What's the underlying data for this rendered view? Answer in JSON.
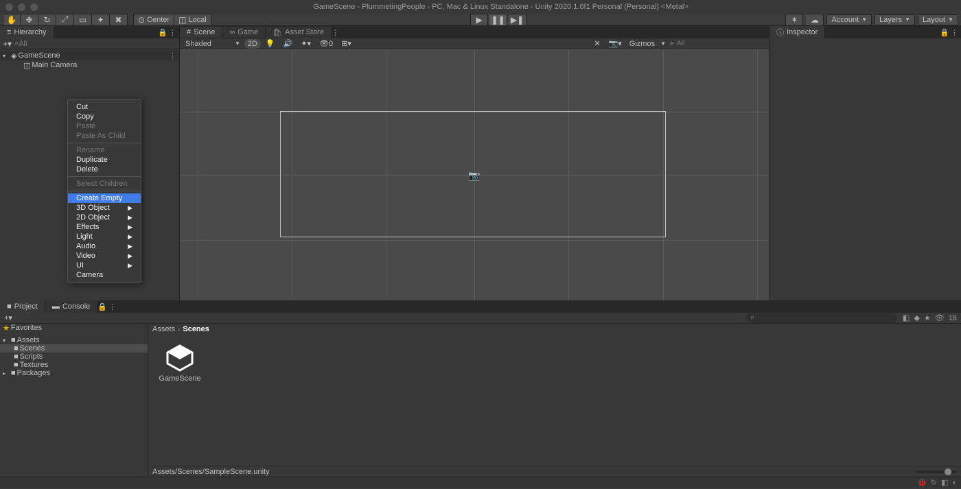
{
  "titlebar": {
    "title": "GameScene - PlummetingPeople - PC, Mac & Linux Standalone - Unity 2020.1.6f1 Personal (Personal) <Metal>"
  },
  "toolbar": {
    "center_label": "Center",
    "local_label": "Local",
    "account_label": "Account",
    "layers_label": "Layers",
    "layout_label": "Layout"
  },
  "hierarchy": {
    "tab_label": "Hierarchy",
    "search_placeholder": "All",
    "scene_name": "GameScene",
    "items": [
      "Main Camera"
    ]
  },
  "scene": {
    "tabs": {
      "scene": "Scene",
      "game": "Game",
      "asset_store": "Asset Store"
    },
    "shaded": "Shaded",
    "mode_2d": "2D",
    "gizmos": "Gizmos",
    "search_placeholder": "All"
  },
  "inspector": {
    "tab_label": "Inspector"
  },
  "context_menu": {
    "cut": "Cut",
    "copy": "Copy",
    "paste": "Paste",
    "paste_as_child": "Paste As Child",
    "rename": "Rename",
    "duplicate": "Duplicate",
    "delete": "Delete",
    "select_children": "Select Children",
    "create_empty": "Create Empty",
    "obj3d": "3D Object",
    "obj2d": "2D Object",
    "effects": "Effects",
    "light": "Light",
    "audio": "Audio",
    "video": "Video",
    "ui": "UI",
    "camera": "Camera"
  },
  "project": {
    "tab_project": "Project",
    "tab_console": "Console",
    "favorites": "Favorites",
    "assets": "Assets",
    "folders": [
      "Scenes",
      "Scripts",
      "Textures"
    ],
    "packages": "Packages",
    "breadcrumb": {
      "root": "Assets",
      "current": "Scenes"
    },
    "asset_name": "GameScene",
    "hidden_count": "18",
    "status_path": "Assets/Scenes/SampleScene.unity"
  }
}
